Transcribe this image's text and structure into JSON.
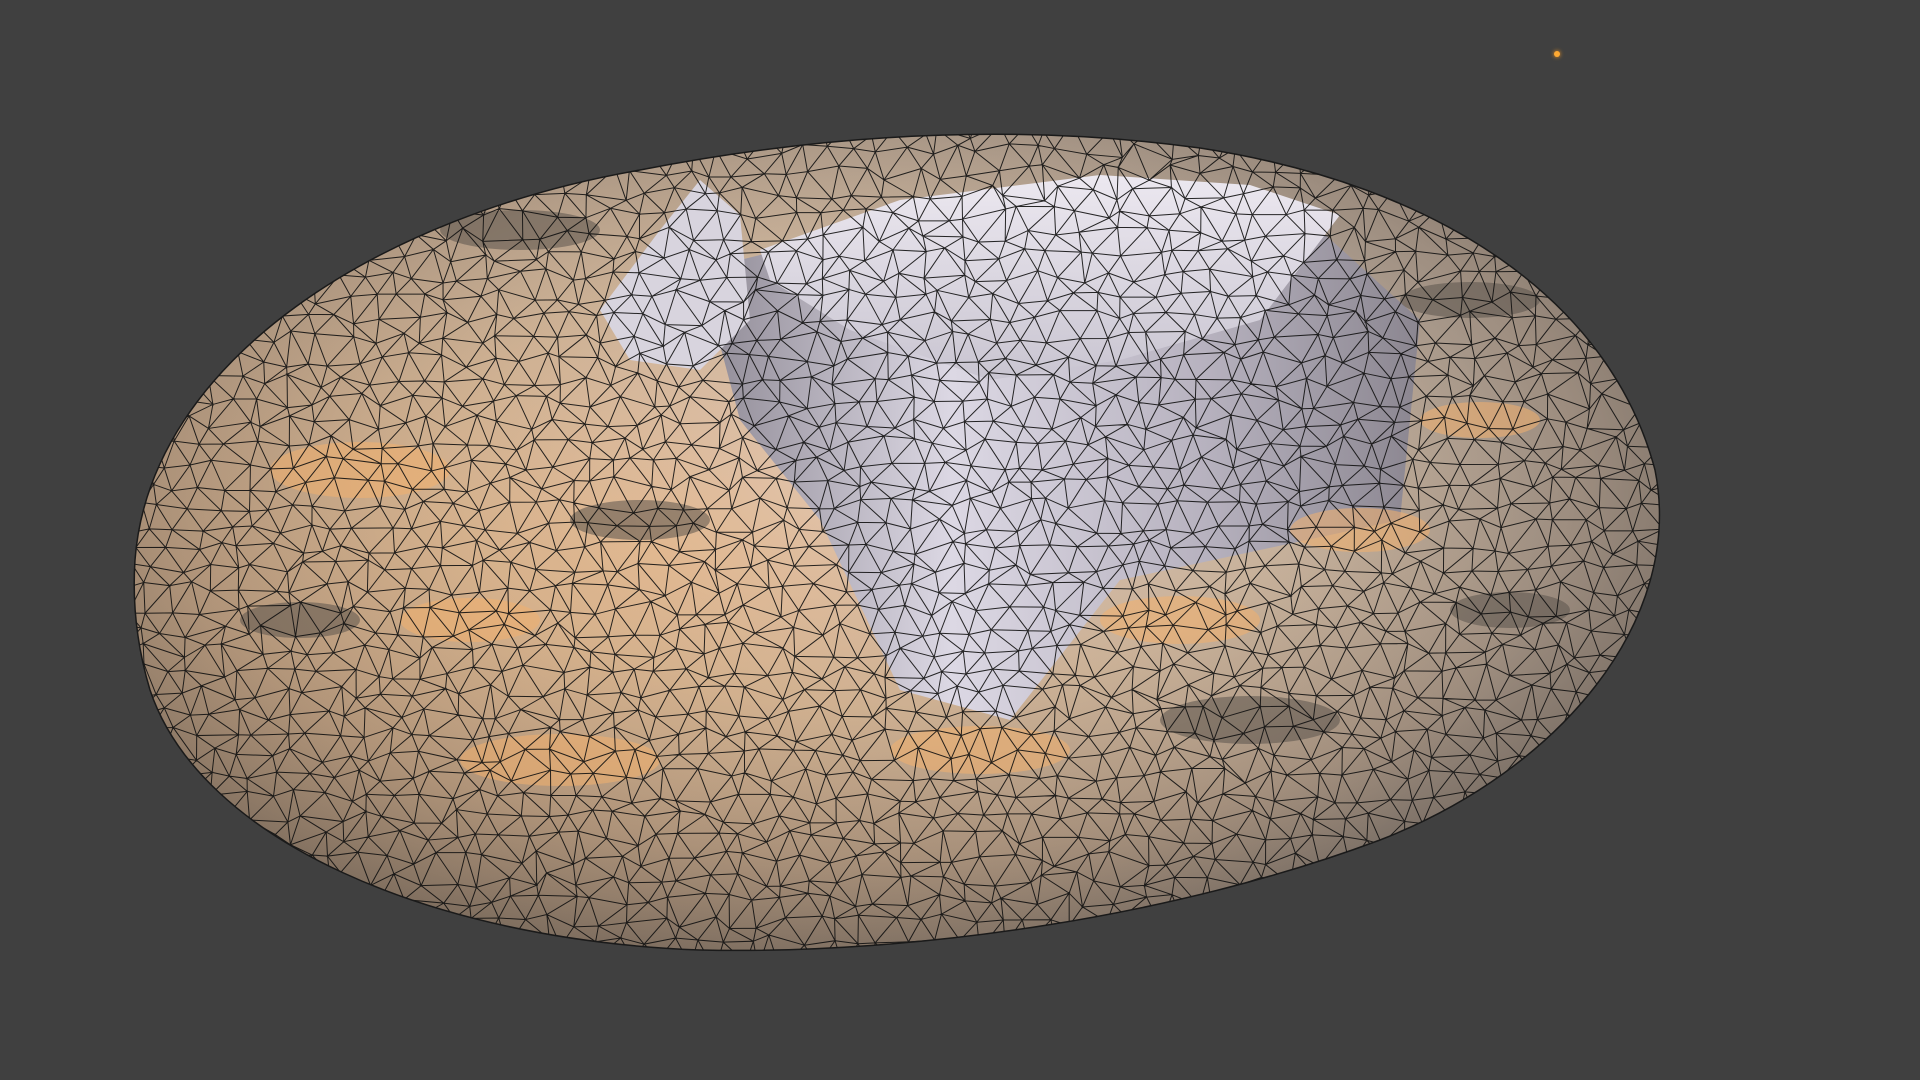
{
  "viewport": {
    "background_color": "#404040"
  },
  "mesh": {
    "shading": "solid",
    "overlay": "wireframe",
    "surface_light_color": "#f0efff",
    "surface_warm_color": "#f4b06c",
    "surface_shadow_color": "#4a4642",
    "wire_color": "#111111"
  },
  "light": {
    "icon": "point-light-icon",
    "color": "#ffaa33"
  }
}
